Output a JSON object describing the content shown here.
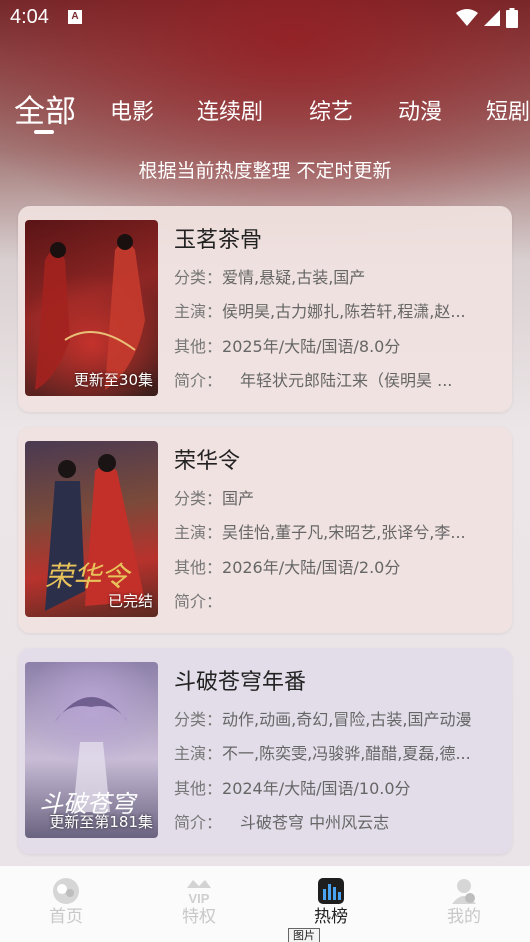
{
  "status": {
    "time": "4:04",
    "app_badge": "A"
  },
  "tabs": [
    {
      "label": "全部"
    },
    {
      "label": "电影"
    },
    {
      "label": "连续剧"
    },
    {
      "label": "综艺"
    },
    {
      "label": "动漫"
    },
    {
      "label": "短剧"
    }
  ],
  "subtitle": "根据当前热度整理 不定时更新",
  "labels": {
    "category": "分类：",
    "cast": "主演：",
    "other": "其他：",
    "intro": "简介："
  },
  "cards": [
    {
      "title": "玉茗茶骨",
      "badge": "更新至30集",
      "category": "爱情,悬疑,古装,国产",
      "cast": "侯明昊,古力娜扎,陈若轩,程潇,赵...",
      "other": "2025年/大陆/国语/8.0分",
      "intro": "年轻状元郎陆江来（侯明昊 ...",
      "poster_colors": [
        "#7a1a1c",
        "#b0302a",
        "#3a1f1c"
      ]
    },
    {
      "title": "荣华令",
      "badge": "已完结",
      "category": "国产",
      "cast": "吴佳怡,董子凡,宋昭艺,张译兮,李...",
      "other": "2026年/大陆/国语/2.0分",
      "intro": "",
      "poster_colors": [
        "#3b2f4a",
        "#b8322d",
        "#c99b4c"
      ]
    },
    {
      "title": "斗破苍穹年番",
      "badge": "更新至第181集",
      "category": "动作,动画,奇幻,冒险,古装,国产动漫",
      "cast": "不一,陈奕雯,冯骏骅,醋醋,夏磊,德...",
      "other": "2024年/大陆/国语/10.0分",
      "intro": "斗破苍穹 中州风云志",
      "poster_colors": [
        "#8a7fa6",
        "#c9b9d8",
        "#4b4566"
      ]
    }
  ],
  "nav": [
    {
      "label": "首页",
      "icon": "home-icon"
    },
    {
      "label": "特权",
      "icon": "vip-crown-icon",
      "icon_text": "VIP"
    },
    {
      "label": "热榜",
      "icon": "chart-icon"
    },
    {
      "label": "我的",
      "icon": "profile-icon"
    }
  ],
  "tooltip": "图片"
}
